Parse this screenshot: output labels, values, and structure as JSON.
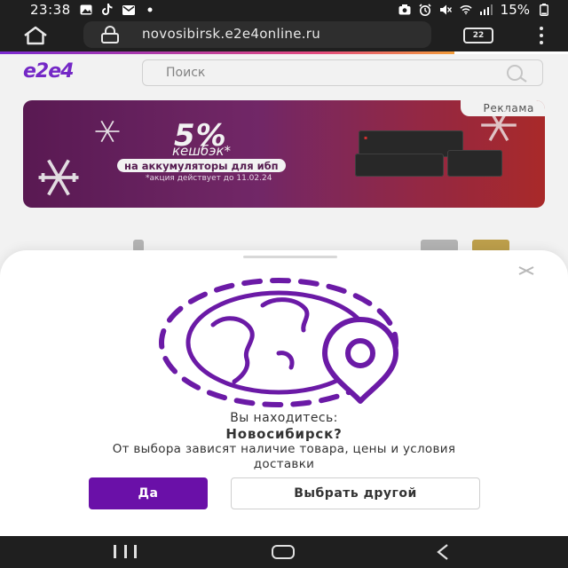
{
  "status_bar": {
    "time": "23:38",
    "battery": "15%",
    "left_icons": [
      "gallery-icon",
      "tiktok-icon",
      "mail-icon",
      "dot-icon"
    ],
    "right_icons": [
      "camera-icon",
      "alarm-icon",
      "mute-icon",
      "wifi-icon",
      "signal-icon",
      "battery-icon"
    ]
  },
  "browser": {
    "url": "novosibirsk.e2e4online.ru",
    "tab_count": "22"
  },
  "site": {
    "logo": "e2e4",
    "search_placeholder": "Поиск",
    "banner": {
      "ad_label": "Реклама",
      "percent": "5%",
      "cashback": "кешбэк*",
      "subtitle": "на аккумуляторы для ибп",
      "note": "*акция действует до 11.02.24"
    }
  },
  "modal": {
    "question_line1": "Вы находитесь:",
    "city": "Новосибирск?",
    "note": "От выбора зависят наличие товара, цены и условия доставки",
    "confirm_label": "Да",
    "choose_other_label": "Выбрать другой"
  },
  "colors": {
    "brand_purple": "#6a10a8",
    "illustration_purple": "#6b1aa6",
    "system_bar": "#1f1f1f"
  }
}
